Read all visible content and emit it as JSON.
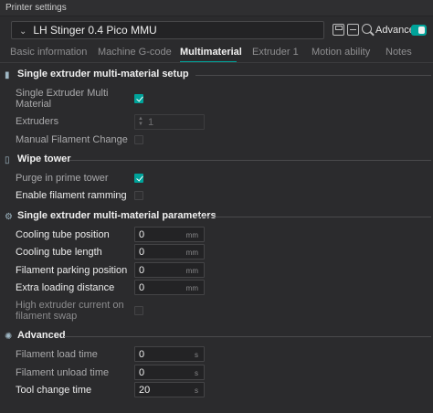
{
  "window": {
    "title": "Printer settings"
  },
  "preset": {
    "name": "LH Stinger 0.4 Pico MMU"
  },
  "toolbar": {
    "advanced_label": "Advanced",
    "advanced_on": true
  },
  "tabs": [
    {
      "label": "Basic information"
    },
    {
      "label": "Machine G-code"
    },
    {
      "label": "Multimaterial",
      "active": true
    },
    {
      "label": "Extruder 1"
    },
    {
      "label": "Motion ability"
    },
    {
      "label": "Notes"
    }
  ],
  "sections": {
    "single_extruder": {
      "title": "Single extruder multi-material setup",
      "single_extruder_mm_label_line1": "Single Extruder Multi",
      "single_extruder_mm_label_line2": "Material",
      "single_extruder_mm_checked": true,
      "extruders_label": "Extruders",
      "extruders_value": "1",
      "manual_filament_change_label": "Manual Filament Change",
      "manual_filament_change_checked": false
    },
    "wipe_tower": {
      "title": "Wipe tower",
      "purge_label": "Purge in prime tower",
      "purge_checked": true,
      "ramming_label": "Enable filament ramming",
      "ramming_checked": false
    },
    "parameters": {
      "title": "Single extruder multi-material parameters",
      "cooling_tube_position_label": "Cooling tube position",
      "cooling_tube_position_value": "0",
      "cooling_tube_length_label": "Cooling tube length",
      "cooling_tube_length_value": "0",
      "filament_parking_label": "Filament parking position",
      "filament_parking_value": "0",
      "extra_loading_label": "Extra loading distance",
      "extra_loading_value": "0",
      "high_current_label_line1": "High extruder current on",
      "high_current_label_line2": "filament swap",
      "high_current_checked": false,
      "unit": "mm"
    },
    "advanced": {
      "title": "Advanced",
      "load_time_label": "Filament load time",
      "load_time_value": "0",
      "unload_time_label": "Filament unload time",
      "unload_time_value": "0",
      "tool_change_label": "Tool change time",
      "tool_change_value": "20",
      "unit": "s"
    }
  },
  "colors": {
    "accent": "#00a39a",
    "background": "#2b2b2d"
  }
}
